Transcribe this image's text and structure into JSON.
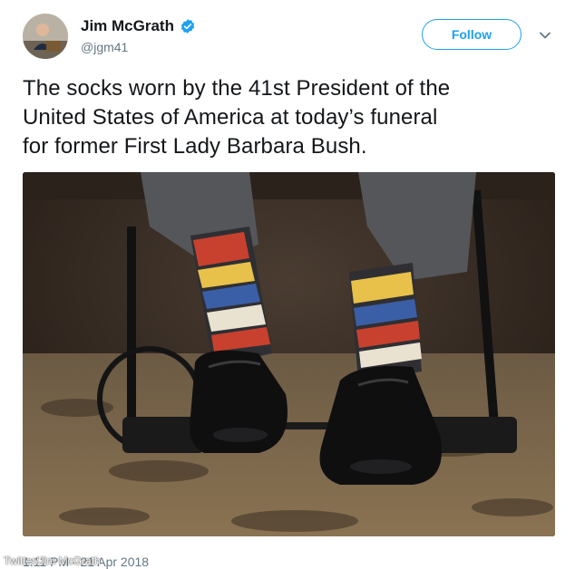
{
  "author": {
    "name": "Jim McGrath",
    "handle": "@jgm41",
    "verified": true
  },
  "actions": {
    "follow_label": "Follow"
  },
  "tweet": {
    "text_lines": [
      "The socks worn by the 41st President of the",
      "United States of America at today’s funeral",
      "for former First Lady Barbara Bush."
    ],
    "timestamp": "1:11 PM - 21 Apr 2018"
  },
  "photo": {
    "description_icon": "photo-socks"
  },
  "watermark": {
    "text": "Twitter/Jim McGrath"
  },
  "colors": {
    "accent": "#1da1f2",
    "text": "#14171a",
    "muted": "#657786"
  }
}
